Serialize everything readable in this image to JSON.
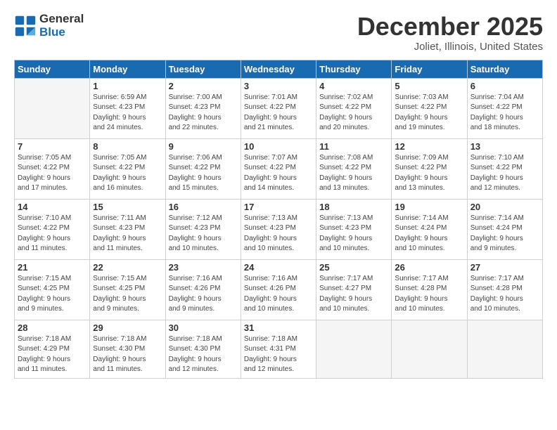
{
  "logo": {
    "general": "General",
    "blue": "Blue"
  },
  "title": "December 2025",
  "location": "Joliet, Illinois, United States",
  "days_of_week": [
    "Sunday",
    "Monday",
    "Tuesday",
    "Wednesday",
    "Thursday",
    "Friday",
    "Saturday"
  ],
  "weeks": [
    [
      {
        "num": "",
        "info": ""
      },
      {
        "num": "1",
        "info": "Sunrise: 6:59 AM\nSunset: 4:23 PM\nDaylight: 9 hours\nand 24 minutes."
      },
      {
        "num": "2",
        "info": "Sunrise: 7:00 AM\nSunset: 4:23 PM\nDaylight: 9 hours\nand 22 minutes."
      },
      {
        "num": "3",
        "info": "Sunrise: 7:01 AM\nSunset: 4:22 PM\nDaylight: 9 hours\nand 21 minutes."
      },
      {
        "num": "4",
        "info": "Sunrise: 7:02 AM\nSunset: 4:22 PM\nDaylight: 9 hours\nand 20 minutes."
      },
      {
        "num": "5",
        "info": "Sunrise: 7:03 AM\nSunset: 4:22 PM\nDaylight: 9 hours\nand 19 minutes."
      },
      {
        "num": "6",
        "info": "Sunrise: 7:04 AM\nSunset: 4:22 PM\nDaylight: 9 hours\nand 18 minutes."
      }
    ],
    [
      {
        "num": "7",
        "info": "Sunrise: 7:05 AM\nSunset: 4:22 PM\nDaylight: 9 hours\nand 17 minutes."
      },
      {
        "num": "8",
        "info": "Sunrise: 7:05 AM\nSunset: 4:22 PM\nDaylight: 9 hours\nand 16 minutes."
      },
      {
        "num": "9",
        "info": "Sunrise: 7:06 AM\nSunset: 4:22 PM\nDaylight: 9 hours\nand 15 minutes."
      },
      {
        "num": "10",
        "info": "Sunrise: 7:07 AM\nSunset: 4:22 PM\nDaylight: 9 hours\nand 14 minutes."
      },
      {
        "num": "11",
        "info": "Sunrise: 7:08 AM\nSunset: 4:22 PM\nDaylight: 9 hours\nand 13 minutes."
      },
      {
        "num": "12",
        "info": "Sunrise: 7:09 AM\nSunset: 4:22 PM\nDaylight: 9 hours\nand 13 minutes."
      },
      {
        "num": "13",
        "info": "Sunrise: 7:10 AM\nSunset: 4:22 PM\nDaylight: 9 hours\nand 12 minutes."
      }
    ],
    [
      {
        "num": "14",
        "info": "Sunrise: 7:10 AM\nSunset: 4:22 PM\nDaylight: 9 hours\nand 11 minutes."
      },
      {
        "num": "15",
        "info": "Sunrise: 7:11 AM\nSunset: 4:23 PM\nDaylight: 9 hours\nand 11 minutes."
      },
      {
        "num": "16",
        "info": "Sunrise: 7:12 AM\nSunset: 4:23 PM\nDaylight: 9 hours\nand 10 minutes."
      },
      {
        "num": "17",
        "info": "Sunrise: 7:13 AM\nSunset: 4:23 PM\nDaylight: 9 hours\nand 10 minutes."
      },
      {
        "num": "18",
        "info": "Sunrise: 7:13 AM\nSunset: 4:23 PM\nDaylight: 9 hours\nand 10 minutes."
      },
      {
        "num": "19",
        "info": "Sunrise: 7:14 AM\nSunset: 4:24 PM\nDaylight: 9 hours\nand 10 minutes."
      },
      {
        "num": "20",
        "info": "Sunrise: 7:14 AM\nSunset: 4:24 PM\nDaylight: 9 hours\nand 9 minutes."
      }
    ],
    [
      {
        "num": "21",
        "info": "Sunrise: 7:15 AM\nSunset: 4:25 PM\nDaylight: 9 hours\nand 9 minutes."
      },
      {
        "num": "22",
        "info": "Sunrise: 7:15 AM\nSunset: 4:25 PM\nDaylight: 9 hours\nand 9 minutes."
      },
      {
        "num": "23",
        "info": "Sunrise: 7:16 AM\nSunset: 4:26 PM\nDaylight: 9 hours\nand 9 minutes."
      },
      {
        "num": "24",
        "info": "Sunrise: 7:16 AM\nSunset: 4:26 PM\nDaylight: 9 hours\nand 10 minutes."
      },
      {
        "num": "25",
        "info": "Sunrise: 7:17 AM\nSunset: 4:27 PM\nDaylight: 9 hours\nand 10 minutes."
      },
      {
        "num": "26",
        "info": "Sunrise: 7:17 AM\nSunset: 4:28 PM\nDaylight: 9 hours\nand 10 minutes."
      },
      {
        "num": "27",
        "info": "Sunrise: 7:17 AM\nSunset: 4:28 PM\nDaylight: 9 hours\nand 10 minutes."
      }
    ],
    [
      {
        "num": "28",
        "info": "Sunrise: 7:18 AM\nSunset: 4:29 PM\nDaylight: 9 hours\nand 11 minutes."
      },
      {
        "num": "29",
        "info": "Sunrise: 7:18 AM\nSunset: 4:30 PM\nDaylight: 9 hours\nand 11 minutes."
      },
      {
        "num": "30",
        "info": "Sunrise: 7:18 AM\nSunset: 4:30 PM\nDaylight: 9 hours\nand 12 minutes."
      },
      {
        "num": "31",
        "info": "Sunrise: 7:18 AM\nSunset: 4:31 PM\nDaylight: 9 hours\nand 12 minutes."
      },
      {
        "num": "",
        "info": ""
      },
      {
        "num": "",
        "info": ""
      },
      {
        "num": "",
        "info": ""
      }
    ]
  ]
}
